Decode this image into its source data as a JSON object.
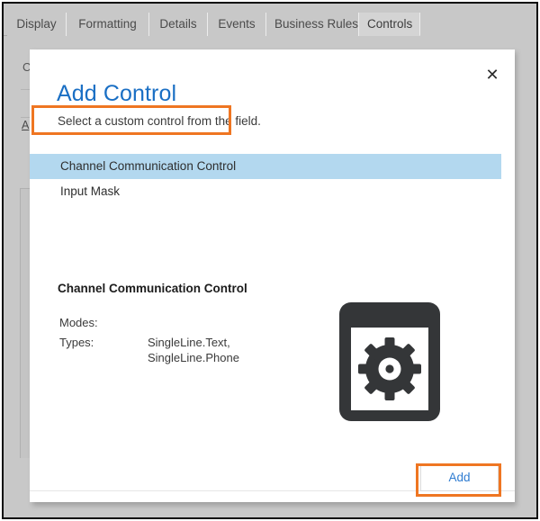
{
  "window": {
    "background_color": "#c8c8c8",
    "frame_color": "#0b0b0b"
  },
  "tabs": {
    "items": [
      {
        "label": "Display",
        "active": false
      },
      {
        "label": "Formatting",
        "active": false
      },
      {
        "label": "Details",
        "active": false
      },
      {
        "label": "Events",
        "active": false
      },
      {
        "label": "Business Rules",
        "active": false
      },
      {
        "label": "Controls",
        "active": true
      }
    ]
  },
  "background_form": {
    "partial_label": "C",
    "partial_link": "A"
  },
  "dialog": {
    "title": "Add Control",
    "subtitle": "Select a custom control from the field.",
    "close_label": "✕",
    "close_icon": "close-icon",
    "title_color": "#1a6fc4",
    "selection_color": "#b3d8ef",
    "annotation_color": "#ef7622",
    "controls": [
      {
        "label": "Channel Communication Control",
        "selected": true
      },
      {
        "label": "Input Mask",
        "selected": false
      }
    ],
    "details": {
      "heading": "Channel Communication Control",
      "rows": [
        {
          "key": "Modes:",
          "value": ""
        },
        {
          "key": "Types:",
          "value": "SingleLine.Text,\nSingleLine.Phone"
        }
      ],
      "preview_icon": "window-gear-icon"
    },
    "footer": {
      "add_label": "Add",
      "add_text_color": "#2f7cd1"
    }
  }
}
